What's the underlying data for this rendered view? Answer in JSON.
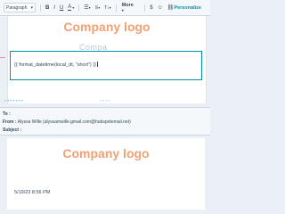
{
  "toolbar": {
    "paragraph": "Paragraph",
    "bold": "B",
    "italic": "I",
    "underline": "U",
    "text_color": "A",
    "more": "More",
    "personalize": "Personalize"
  },
  "editor": {
    "logo": "Company logo",
    "ghost_text": "Compa",
    "code": "{{ format_datetime(local_dt, \"short\") }}"
  },
  "email_header": {
    "to_label": "To :",
    "to_value": "",
    "from_label": "From :",
    "from_value": "Alyssa Wille (alyssamwille.gmail.com@hubspotemail.net)",
    "subject_label": "Subject :",
    "subject_value": ""
  },
  "preview": {
    "logo": "Company logo",
    "date": "5/19/23 8:56 PM"
  },
  "colors": {
    "accent": "#0091ae",
    "logo": "#f2a074"
  }
}
